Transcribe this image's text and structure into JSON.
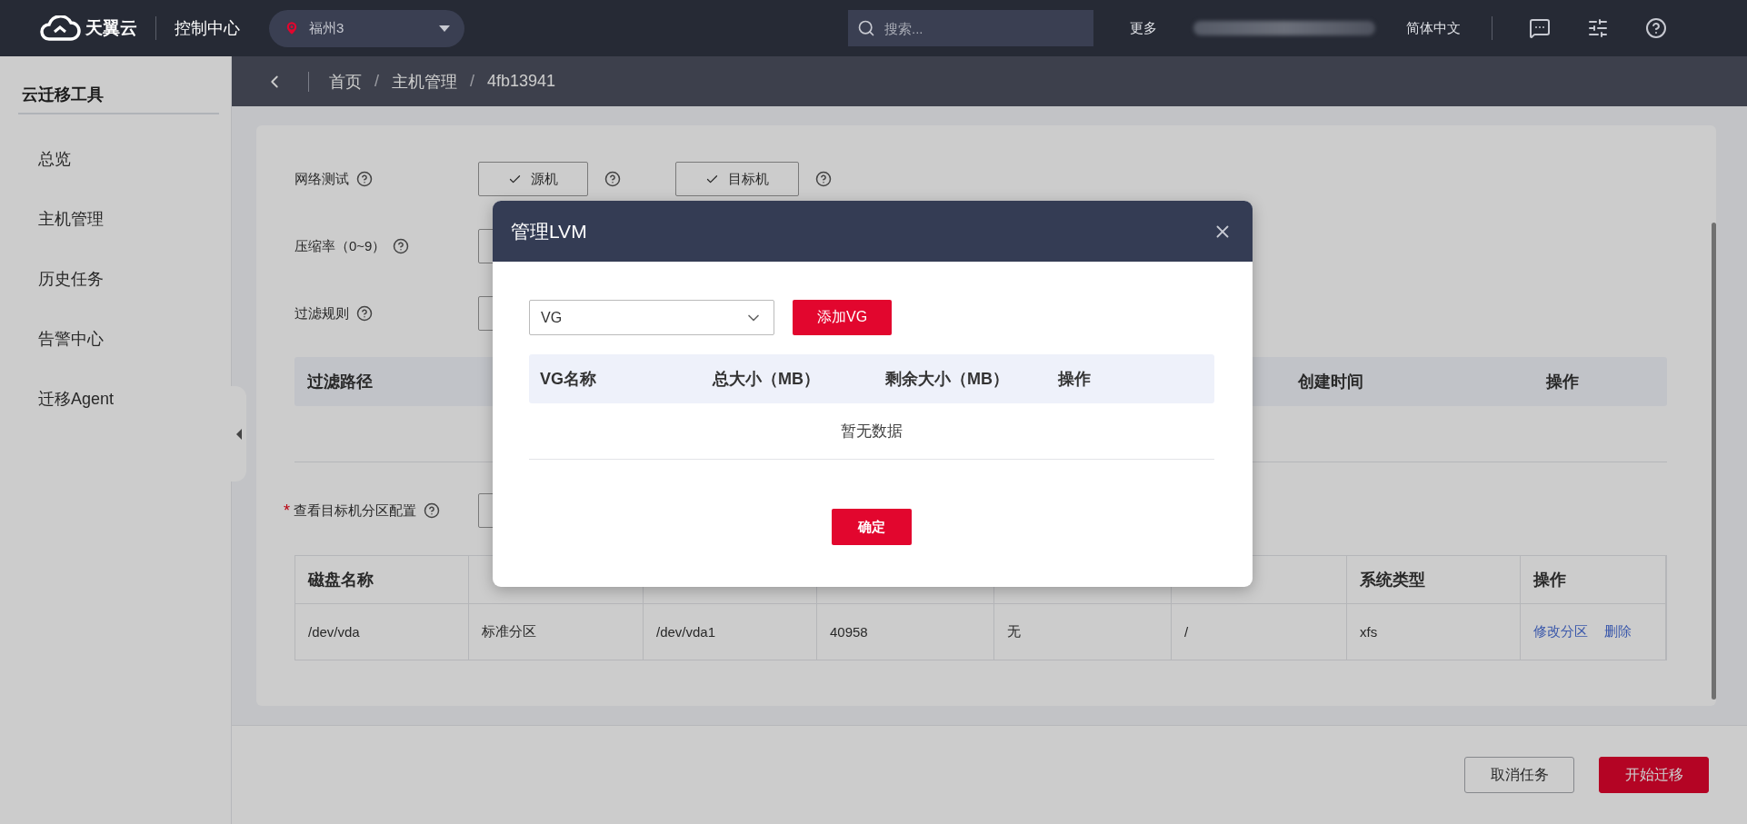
{
  "topbar": {
    "brand": "天翼云",
    "console": "控制中心",
    "region": "福州3",
    "search": {
      "placeholder": "搜索..."
    },
    "more": "更多",
    "language": "简体中文"
  },
  "sidebar": {
    "title": "云迁移工具",
    "items": [
      {
        "label": "总览",
        "selected": false
      },
      {
        "label": "主机管理",
        "selected": false
      },
      {
        "label": "历史任务",
        "selected": false
      },
      {
        "label": "告警中心",
        "selected": false
      },
      {
        "label": "迁移Agent",
        "selected": false
      }
    ]
  },
  "breadcrumb": {
    "separator": "/",
    "items": [
      "首页",
      "主机管理",
      "4fb13941"
    ]
  },
  "form": {
    "network_test": {
      "label": "网络测试",
      "buttons": [
        {
          "label": "源机",
          "checked": true
        },
        {
          "label": "目标机",
          "checked": true
        }
      ]
    },
    "compression": {
      "label": "压缩率（0~9）"
    },
    "filter_rules": {
      "label": "过滤规则"
    },
    "filter_table": {
      "columns": [
        "过滤路径",
        "创建时间",
        "操作"
      ]
    },
    "partition_config": {
      "label": "查看目标机分区配置",
      "required_mark": "*"
    },
    "partition_table": {
      "columns": [
        "磁盘名称",
        "",
        "",
        "",
        "",
        "",
        "系统类型",
        "操作"
      ],
      "rows": [
        {
          "cells": [
            "/dev/vda",
            "标准分区",
            "/dev/vda1",
            "40958",
            "无",
            "/",
            "xfs"
          ],
          "actions": [
            "修改分区",
            "删除"
          ]
        }
      ]
    }
  },
  "footer": {
    "buttons": [
      {
        "label": "取消任务",
        "kind": "secondary"
      },
      {
        "label": "开始迁移",
        "kind": "primary"
      }
    ]
  },
  "modal": {
    "title": "管理LVM",
    "select": {
      "value": "VG"
    },
    "add_button": "添加VG",
    "table": {
      "columns": [
        "VG名称",
        "总大小（MB）",
        "剩余大小（MB）",
        "操作"
      ],
      "empty_text": "暂无数据"
    },
    "confirm": "确定"
  }
}
